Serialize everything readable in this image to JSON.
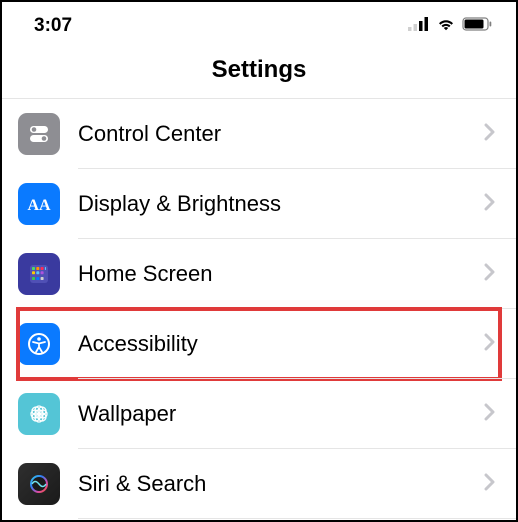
{
  "status": {
    "time": "3:07"
  },
  "header": {
    "title": "Settings"
  },
  "rows": {
    "control": "Control Center",
    "display": "Display & Brightness",
    "home": "Home Screen",
    "accessibility": "Accessibility",
    "wallpaper": "Wallpaper",
    "siri": "Siri & Search"
  },
  "colors": {
    "highlight": "#e03a3a",
    "blue": "#0a7aff",
    "gray": "#8e8e93",
    "teal": "#54c5d6",
    "indigo": "#3a3a9f"
  }
}
